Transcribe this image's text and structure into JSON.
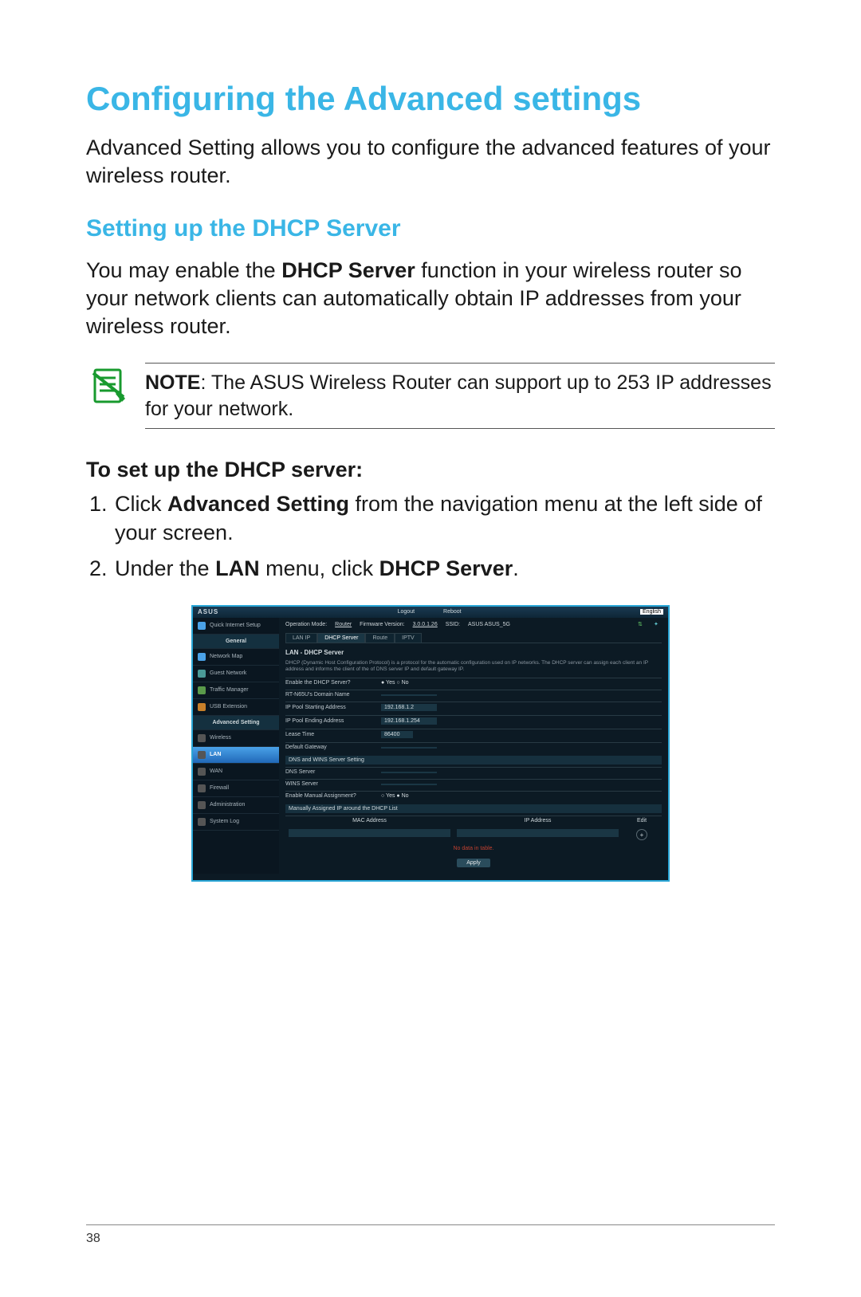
{
  "page_number": "38",
  "heading1": "Configuring the Advanced settings",
  "intro": "Advanced Setting allows you to configure the advanced features of your wireless router.",
  "heading2": "Setting up the DHCP Server",
  "para2_pre": "You may enable the ",
  "para2_bold": "DHCP Server",
  "para2_post": " function in your wireless router so your network clients can automatically obtain IP addresses from your wireless router.",
  "note": {
    "label": "NOTE",
    "text": ": The ASUS Wireless Router can support up to 253 IP addresses for your network."
  },
  "heading3": "To set up the DHCP server:",
  "steps": [
    {
      "n": "1.",
      "pre": "Click ",
      "b": "Advanced Setting",
      "post": " from the navigation menu at the left side of your screen."
    },
    {
      "n": "2.",
      "pre": "Under the ",
      "b": "LAN",
      "mid": " menu, click ",
      "b2": "DHCP Server",
      "post2": "."
    }
  ],
  "screenshot": {
    "brand": "ASUS",
    "top_buttons": [
      "Logout",
      "Reboot"
    ],
    "language": "English",
    "mode_label": "Operation Mode:",
    "mode_value": "Router",
    "fw_label": "Firmware Version:",
    "fw_value": "3.0.0.1.26",
    "ssid_label": "SSID:",
    "ssid_value": "ASUS  ASUS_5G",
    "sidebar": {
      "quick": "Quick Internet Setup",
      "general_header": "General",
      "items_general": [
        "Network Map",
        "Guest Network",
        "Traffic Manager",
        "USB Extension"
      ],
      "adv_header": "Advanced Setting",
      "items_adv": [
        "Wireless",
        "LAN",
        "WAN",
        "Firewall",
        "Administration",
        "System Log"
      ],
      "active": "LAN"
    },
    "tabs": [
      "LAN IP",
      "DHCP Server",
      "Route",
      "IPTV"
    ],
    "active_tab": "DHCP Server",
    "panel_title": "LAN - DHCP Server",
    "panel_desc": "DHCP (Dynamic Host Configuration Protocol) is a protocol for the automatic configuration used on IP networks. The DHCP server can assign each client an IP address and informs the client of the of DNS server IP and default gateway IP.",
    "fields": {
      "enable_label": "Enable the DHCP Server?",
      "enable_val": "● Yes  ○ No",
      "domain_label": "RT-N65U's Domain Name",
      "domain_val": "",
      "start_label": "IP Pool Starting Address",
      "start_val": "192.168.1.2",
      "end_label": "IP Pool Ending Address",
      "end_val": "192.168.1.254",
      "lease_label": "Lease Time",
      "lease_val": "86400",
      "gateway_label": "Default Gateway",
      "gateway_val": ""
    },
    "dns_section": "DNS and WINS Server Setting",
    "dns_label": "DNS Server",
    "wins_label": "WINS Server",
    "manual_label": "Enable Manual Assignment?",
    "manual_val": "○ Yes  ● No",
    "list_section": "Manually Assigned IP around the DHCP List",
    "list_cols": [
      "MAC Address",
      "IP Address",
      "Edit"
    ],
    "no_data": "No data in table.",
    "apply": "Apply"
  }
}
